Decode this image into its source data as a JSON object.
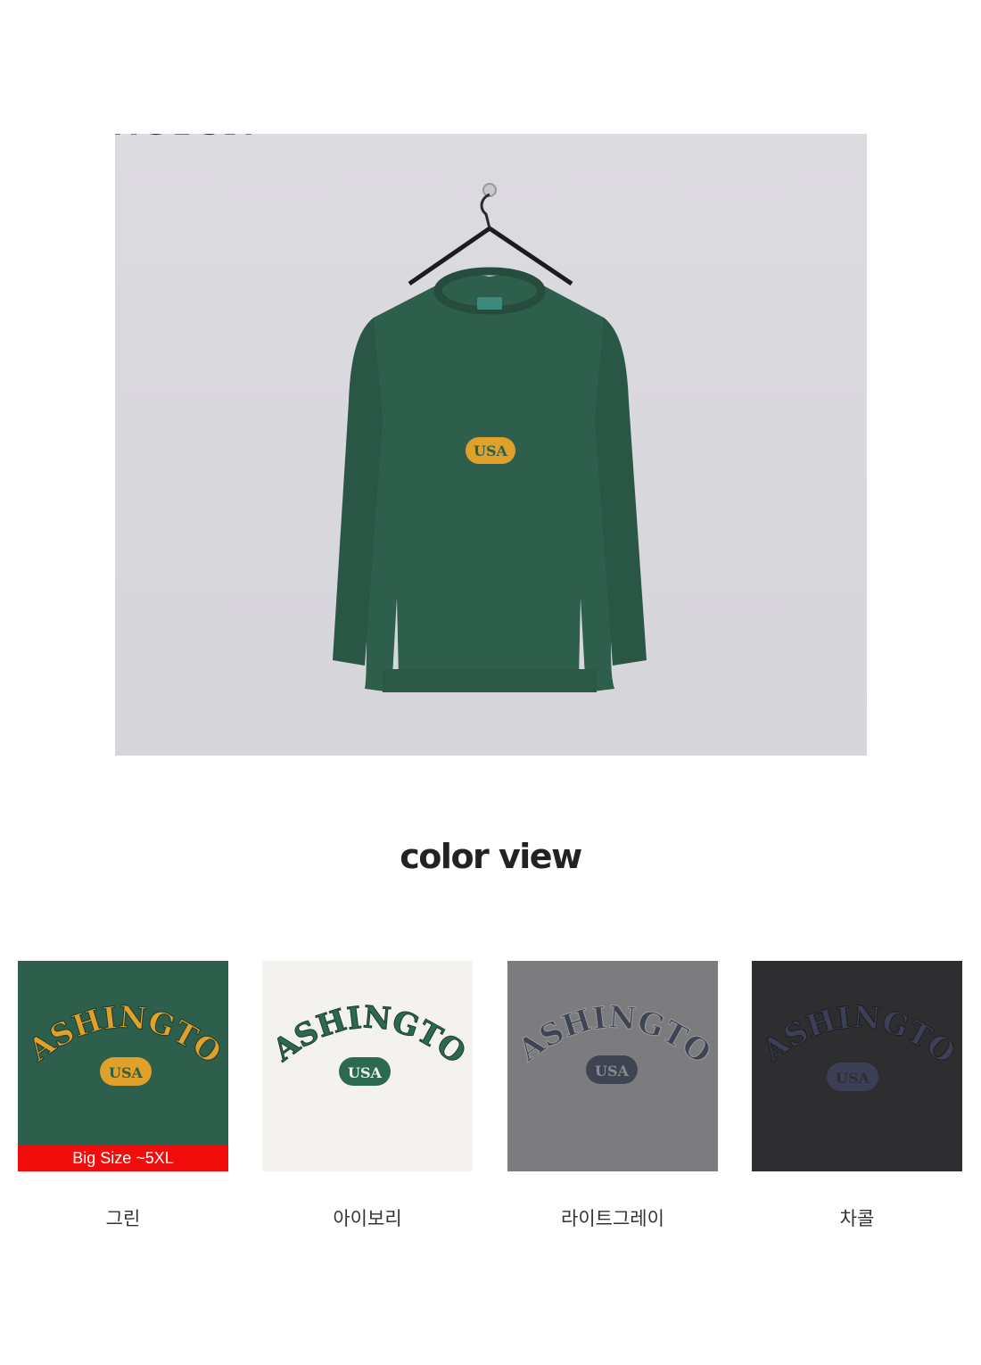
{
  "hero": {
    "print_text": "WASHINGTON",
    "print_sub": "USA"
  },
  "section_title": "color view",
  "badge": "Big Size ~5XL",
  "swatches": [
    {
      "label": "그린",
      "body": "#2e5e4c",
      "print": "#e0a12a",
      "print_outline": "#1d3a2f",
      "pill_text": "#2e5e4c"
    },
    {
      "label": "아이보리",
      "body": "#f3f2ef",
      "print": "#2c6a4f",
      "print_outline": "#e8e8e4",
      "pill_text": "#f3f2ef"
    },
    {
      "label": "라이트그레이",
      "body": "#7c7c7e",
      "print": "#3f4452",
      "print_outline": "#9a9ba0",
      "pill_text": "#8a8a8c"
    },
    {
      "label": "차콜",
      "body": "#2e2e30",
      "print": "#3d3f57",
      "print_outline": "#2a2a2c",
      "pill_text": "#2e2e30"
    }
  ]
}
